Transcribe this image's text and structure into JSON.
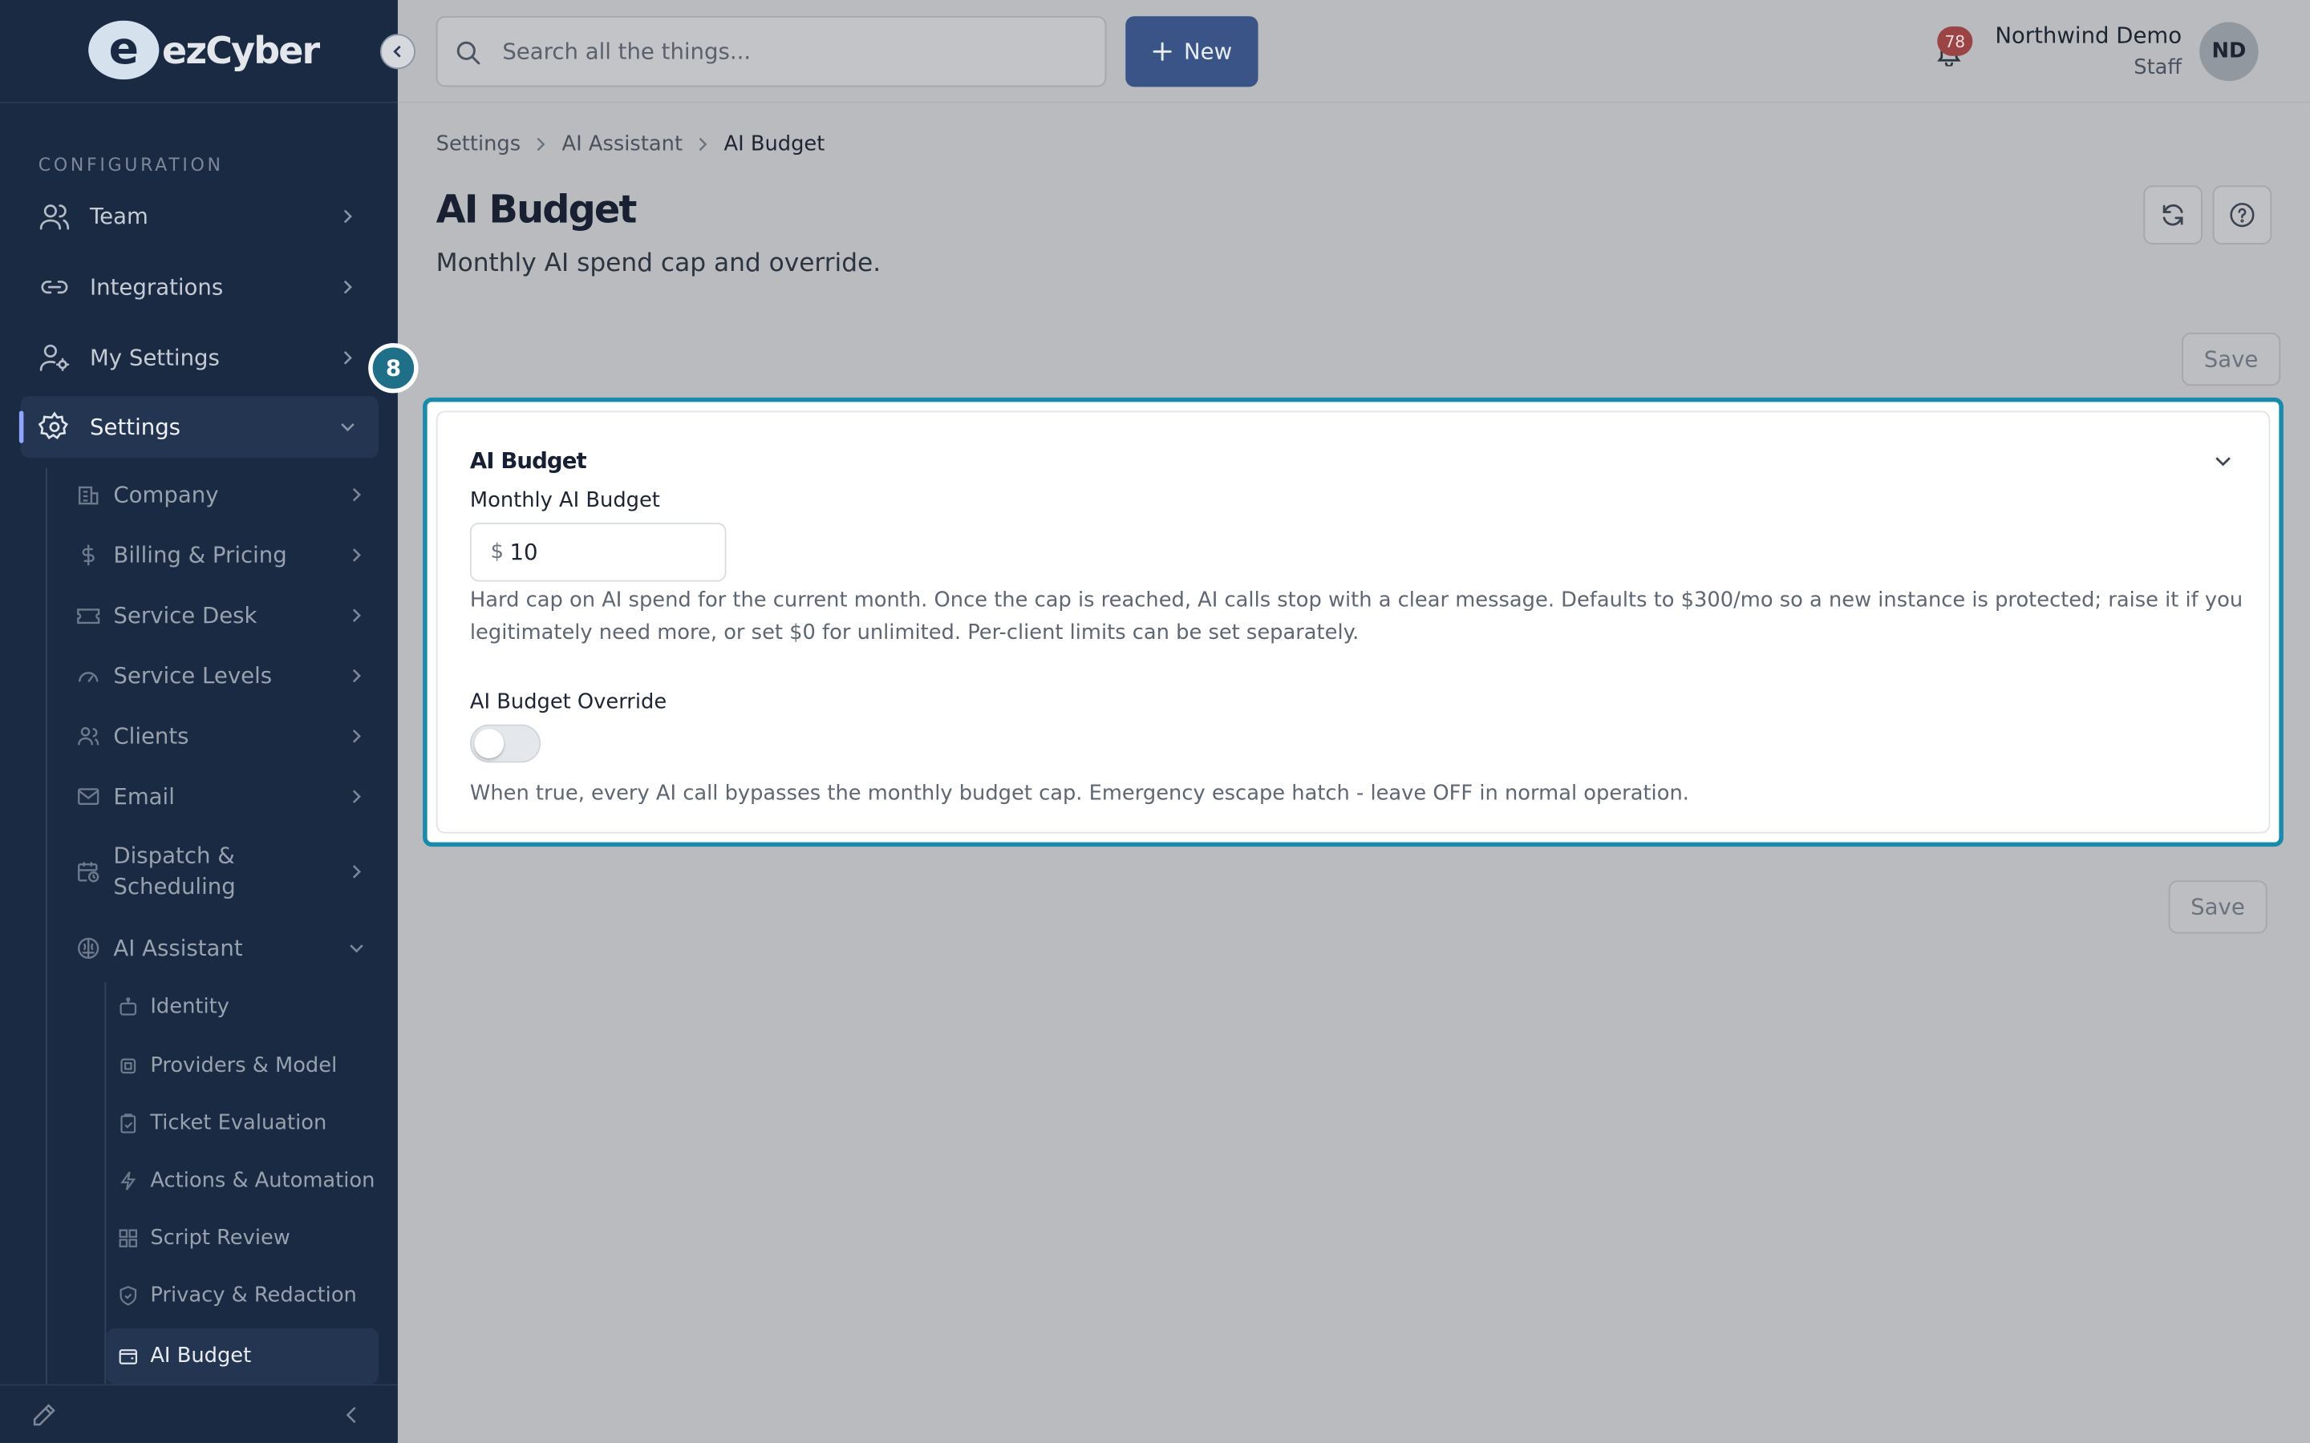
{
  "brand": {
    "logo_letter": "e",
    "logo_text": "ezCyber"
  },
  "sidebar": {
    "section_label": "CONFIGURATION",
    "top_items": [
      {
        "label": "Team",
        "icon": "users-icon"
      },
      {
        "label": "Integrations",
        "icon": "link-icon"
      },
      {
        "label": "My Settings",
        "icon": "user-cog-icon"
      },
      {
        "label": "Settings",
        "icon": "gear-icon",
        "active": true,
        "expanded": true
      }
    ],
    "settings_children": [
      {
        "label": "Company",
        "icon": "building-icon"
      },
      {
        "label": "Billing & Pricing",
        "icon": "dollar-icon"
      },
      {
        "label": "Service Desk",
        "icon": "ticket-icon"
      },
      {
        "label": "Service Levels",
        "icon": "gauge-icon"
      },
      {
        "label": "Clients",
        "icon": "users-icon"
      },
      {
        "label": "Email",
        "icon": "mail-icon"
      },
      {
        "label": "Dispatch &",
        "label2": "Scheduling",
        "icon": "calendar-clock-icon"
      },
      {
        "label": "AI Assistant",
        "icon": "brain-icon",
        "expanded": true
      }
    ],
    "ai_children": [
      {
        "label": "Identity",
        "icon": "bot-icon"
      },
      {
        "label": "Providers & Model",
        "icon": "cpu-icon"
      },
      {
        "label": "Ticket Evaluation",
        "icon": "clipboard-check-icon"
      },
      {
        "label": "Actions & Automation",
        "icon": "zap-icon"
      },
      {
        "label": "Script Review",
        "icon": "grid-icon"
      },
      {
        "label": "Privacy & Redaction",
        "icon": "shield-icon"
      },
      {
        "label": "AI Budget",
        "icon": "wallet-icon",
        "active": true
      }
    ]
  },
  "topbar": {
    "search_placeholder": "Search all the things...",
    "new_button_label": "New",
    "notification_count": "78",
    "user_name": "Northwind Demo",
    "user_role": "Staff",
    "avatar_initials": "ND"
  },
  "breadcrumb": [
    "Settings",
    "AI Assistant",
    "AI Budget"
  ],
  "page": {
    "title": "AI Budget",
    "subtitle": "Monthly AI spend cap and override.",
    "save_label": "Save",
    "step_marker": "8"
  },
  "card": {
    "title": "AI Budget",
    "budget_label": "Monthly AI Budget",
    "currency_symbol": "$",
    "budget_value": "10",
    "budget_help": "Hard cap on AI spend for the current month. Once the cap is reached, AI calls stop with a clear message. Defaults to $300/mo so a new instance is protected; raise it if you legitimately need more, or set $0 for unlimited. Per-client limits can be set separately.",
    "override_label": "AI Budget Override",
    "override_enabled": false,
    "override_help": "When true, every AI call bypasses the monthly budget cap. Emergency escape hatch - leave OFF in normal operation."
  },
  "colors": {
    "sidebar_bg": "#1b2a43",
    "accent": "#1a8aaa",
    "primary_button": "#3a5488",
    "badge": "#9a4446"
  }
}
